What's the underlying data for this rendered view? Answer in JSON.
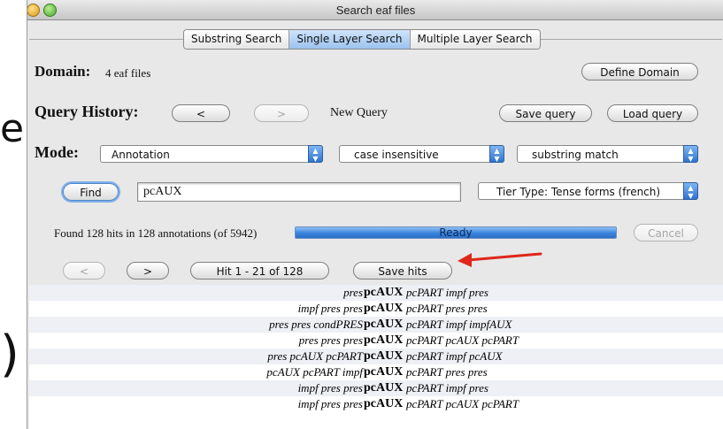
{
  "window": {
    "title": "Search eaf files"
  },
  "tabs": [
    {
      "label": "Substring Search",
      "active": false
    },
    {
      "label": "Single Layer Search",
      "active": true
    },
    {
      "label": "Multiple Layer Search",
      "active": false
    }
  ],
  "domain": {
    "label": "Domain:",
    "value": "4 eaf files",
    "define_button": "Define Domain"
  },
  "history": {
    "label": "Query History:",
    "prev_button": "<",
    "next_button": ">",
    "current": "New Query",
    "save_button": "Save query",
    "load_button": "Load query"
  },
  "mode": {
    "label": "Mode:",
    "type_select": "Annotation",
    "case_select": "case insensitive",
    "match_select": "substring match"
  },
  "query": {
    "find_button": "Find",
    "input_value": "pcAUX",
    "tier_select": "Tier Type: Tense forms (french)"
  },
  "status": {
    "summary": "Found 128 hits in 128 annotations (of 5942)",
    "progress_label": "Ready",
    "progress_fraction": 1.0,
    "cancel_button": "Cancel"
  },
  "hits_nav": {
    "prev_button": "<",
    "next_button": ">",
    "range_button": "Hit 1 - 21 of 128",
    "save_hits_button": "Save hits"
  },
  "arrow_color": "#e0261b",
  "results": [
    {
      "left": "pres",
      "hit": "pcAUX",
      "right": "pcPART  impf  pres"
    },
    {
      "left": "impf  pres  pres",
      "hit": "pcAUX",
      "right": "pcPART  pres  pres"
    },
    {
      "left": "pres  pres  condPRES",
      "hit": "pcAUX",
      "right": "pcPART  impf  impfAUX"
    },
    {
      "left": "pres  pres  pres",
      "hit": "pcAUX",
      "right": "pcPART  pcAUX  pcPART"
    },
    {
      "left": "pres  pcAUX  pcPART",
      "hit": "pcAUX",
      "right": "pcPART  impf  pcAUX"
    },
    {
      "left": "pcAUX  pcPART  impf",
      "hit": "pcAUX",
      "right": "pcPART  pres  pres"
    },
    {
      "left": "impf  pres  pres",
      "hit": "pcAUX",
      "right": "pcPART  impf  pres"
    },
    {
      "left": "impf  pres  pres",
      "hit": "pcAUX",
      "right": "pcPART  pcAUX  pcPART"
    }
  ]
}
